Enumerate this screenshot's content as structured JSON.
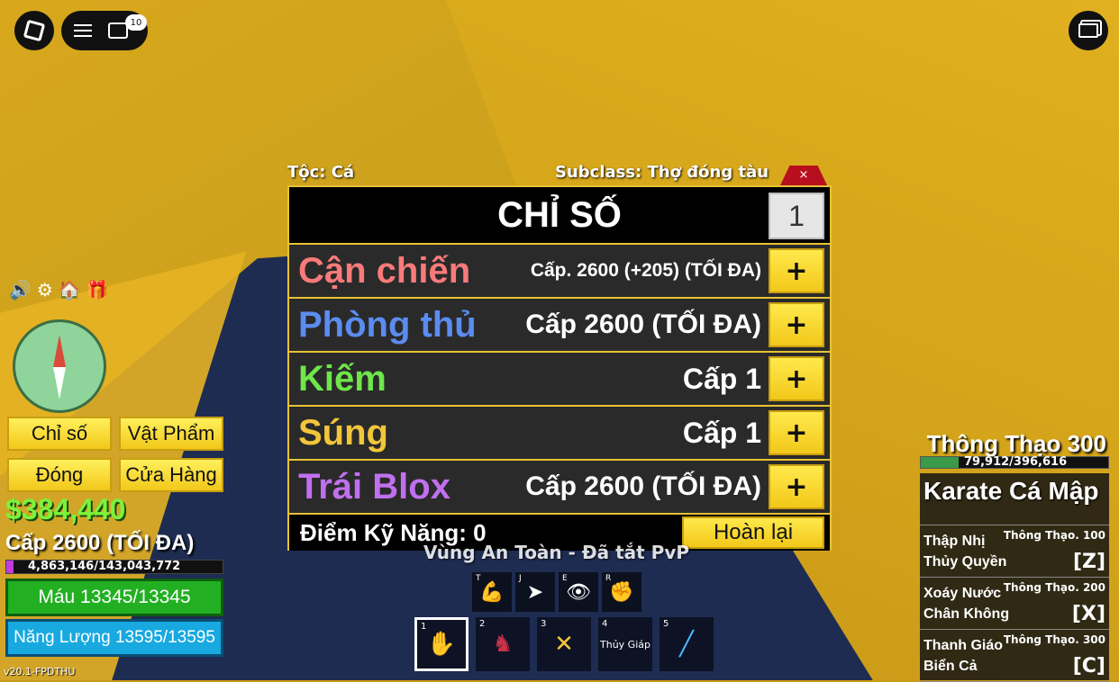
{
  "topbar": {
    "chat_badge": "10"
  },
  "stats_panel": {
    "race": "Tộc: Cá",
    "subclass": "Subclass: Thợ đóng tàu",
    "close": "×",
    "title": "CHỈ SỐ",
    "increment": "1",
    "rows": [
      {
        "name": "Cận chiến",
        "level": "Cấp. 2600 (+205) (TỐI ĐA)",
        "color": "#f87a7a"
      },
      {
        "name": "Phòng thủ",
        "level": "Cấp 2600 (TỐI ĐA)",
        "color": "#5b8cf0"
      },
      {
        "name": "Kiếm",
        "level": "Cấp 1",
        "color": "#6fe64a"
      },
      {
        "name": "Súng",
        "level": "Cấp 1",
        "color": "#f2c63a"
      },
      {
        "name": "Trái Blox",
        "level": "Cấp 2600 (TỐI ĐA)",
        "color": "#c070ee"
      }
    ],
    "plus": "+",
    "skill_points": "Điểm Kỹ Năng: 0",
    "reset": "Hoàn lại"
  },
  "zone_text": "Vùng An Toàn - Đã tắt PvP",
  "left_hud": {
    "buttons": [
      "Chỉ số",
      "Vật Phẩm",
      "Đóng",
      "Cửa Hàng"
    ],
    "money": "$384,440",
    "level": "Cấp 2600 (TỐI ĐA)",
    "xp": "4,863,146/143,043,772",
    "xp_fraction": 0.034,
    "health": "Máu 13345/13345",
    "energy": "Năng Lượng 13595/13595",
    "version": "v20.1-FPDTHU"
  },
  "skills": [
    {
      "key": "T",
      "icon": "muscle-icon"
    },
    {
      "key": "J",
      "icon": "dash-icon"
    },
    {
      "key": "E",
      "icon": "eye-icon"
    },
    {
      "key": "R",
      "icon": "fist-fire-icon"
    }
  ],
  "hotbar": [
    {
      "num": "1",
      "label": "",
      "icon": "shark-fist-icon"
    },
    {
      "num": "2",
      "label": "",
      "icon": "character-icon"
    },
    {
      "num": "3",
      "label": "",
      "icon": "crossed-swords-icon"
    },
    {
      "num": "4",
      "label": "Thủy Giáp",
      "icon": ""
    },
    {
      "num": "5",
      "label": "",
      "icon": "gun-icon"
    }
  ],
  "right_hud": {
    "mastery_title": "Thông Thạo 300",
    "mastery_value": "79,912/396,616",
    "mastery_fraction": 0.2,
    "style": "Karate Cá Mập",
    "moves": [
      {
        "name1": "Thập Nhị",
        "name2": "Thủy Quyền",
        "req": "Thông Thạo. 100",
        "key": "[Z]"
      },
      {
        "name1": "Xoáy Nước",
        "name2": "Chân Không",
        "req": "Thông Thạo. 200",
        "key": "[X]"
      },
      {
        "name1": "Thanh Giáo",
        "name2": "Biển Cả",
        "req": "Thông Thạo. 300",
        "key": "[C]"
      }
    ]
  }
}
